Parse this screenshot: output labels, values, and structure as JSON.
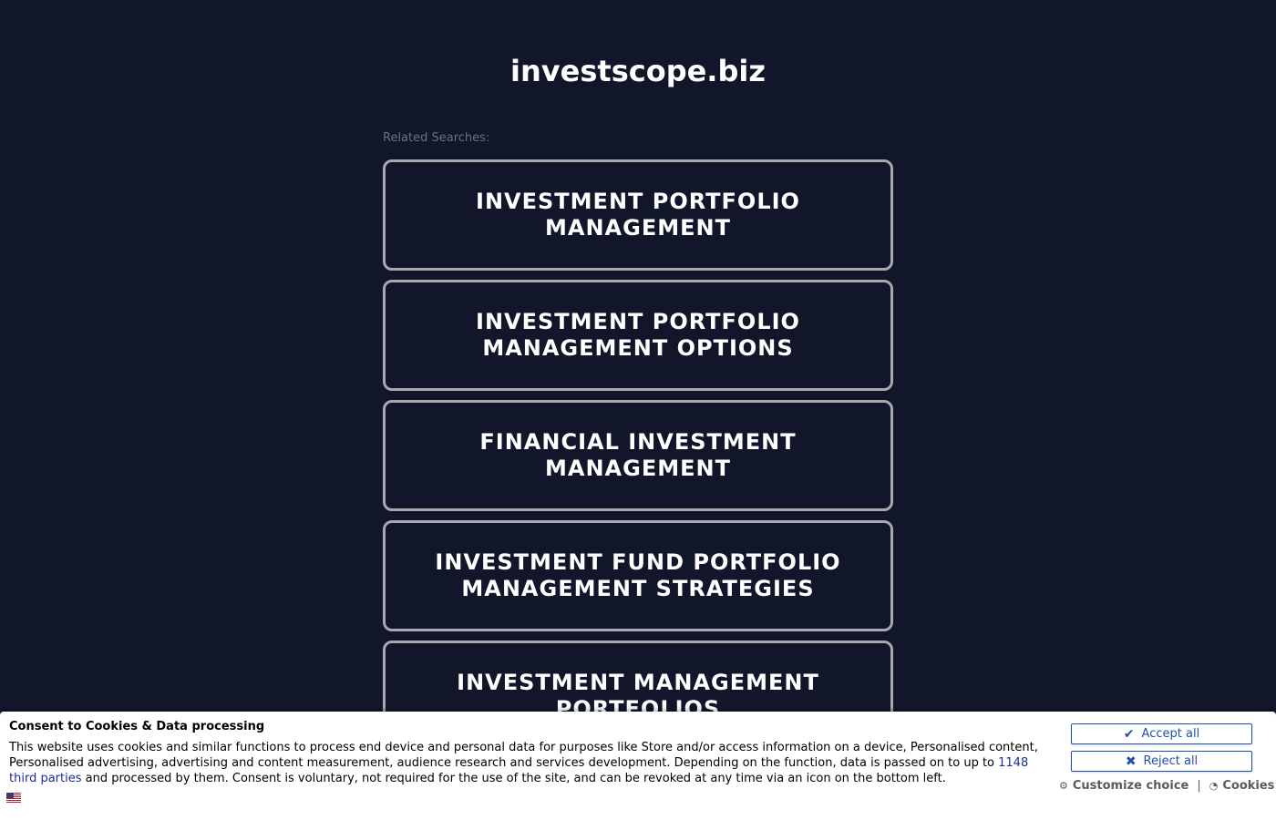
{
  "header": {
    "site_title": "investscope.biz"
  },
  "related": {
    "label": "Related Searches:",
    "items": [
      {
        "label": "INVESTMENT PORTFOLIO MANAGEMENT"
      },
      {
        "label": "INVESTMENT PORTFOLIO MANAGEMENT OPTIONS"
      },
      {
        "label": "FINANCIAL INVESTMENT MANAGEMENT"
      },
      {
        "label": "INVESTMENT FUND PORTFOLIO MANAGEMENT STRATEGIES"
      },
      {
        "label": "INVESTMENT MANAGEMENT PORTFOLIOS"
      }
    ]
  },
  "consent": {
    "title": "Consent to Cookies & Data processing",
    "text_before": "This website uses cookies and similar functions to process end device and personal data for purposes like Store and/or access information on a device, Personalised content, Personalised advertising, advertising and content measurement, audience research and services development. Depending on the function, data is passed on to up to ",
    "link_text": "1148 third parties",
    "text_after": " and processed by them. Consent is voluntary, not required for the use of the site, and can be revoked at any time via an icon on the bottom left.",
    "accept_label": "Accept all",
    "accept_icon": "check-icon",
    "reject_label": "Reject all",
    "reject_icon": "x-icon",
    "customize_label": "Customize choice",
    "customize_icon": "gear-icon",
    "separator": "|",
    "cookies_label": "Cookies",
    "cookies_icon": "cookie-icon",
    "language_icon": "us-flag-icon"
  },
  "colors": {
    "background": "#11162b",
    "card_border": "#a9a9ad",
    "button_accent": "#1f4fa8",
    "link": "#1a2e9e"
  }
}
